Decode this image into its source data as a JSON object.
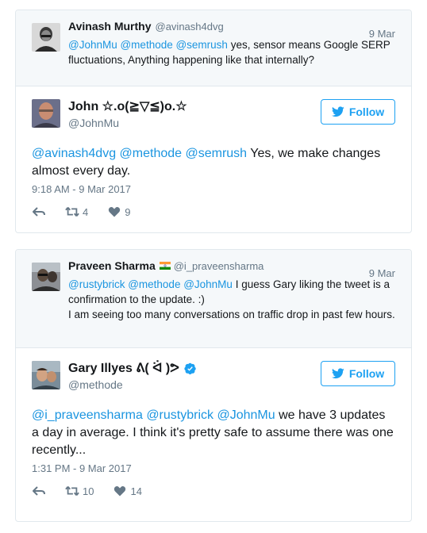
{
  "threads": [
    {
      "quoted": {
        "name": "Avinash Murthy",
        "handle": "@avinash4dvg",
        "date": "9 Mar",
        "mentions": "@JohnMu @methode @semrush",
        "text": " yes, sensor means Google SERP fluctuations, Anything happening like that internally?"
      },
      "reply": {
        "name": "John ☆.o(≧▽≦)o.☆",
        "handle": "@JohnMu",
        "follow_label": "Follow",
        "mentions": "@avinash4dvg @methode @semrush",
        "text": " Yes, we make changes almost every day.",
        "timestamp": "9:18 AM - 9 Mar 2017",
        "retweets": "4",
        "likes": "9"
      }
    },
    {
      "quoted": {
        "name": "Praveen Sharma",
        "handle": "@i_praveensharma",
        "date": "9 Mar",
        "mentions": "@rustybrick @methode @JohnMu",
        "text": " I guess Gary liking the tweet is a confirmation to the update. :)",
        "text2": "I am seeing too many conversations on traffic drop in past few hours."
      },
      "reply": {
        "name": "Gary Illyes ᕕ( ᐛ )ᕗ",
        "handle": "@methode",
        "follow_label": "Follow",
        "mentions": "@i_praveensharma @rustybrick @JohnMu",
        "text": " we have 3 updates a day in average. I think it's pretty safe to assume there was one recently...",
        "timestamp": "1:31 PM - 9 Mar 2017",
        "retweets": "10",
        "likes": "14"
      }
    }
  ],
  "colors": {
    "link": "#1b95e0",
    "follow": "#1da1f2",
    "muted": "#657786",
    "verified": "#1da1f2"
  }
}
